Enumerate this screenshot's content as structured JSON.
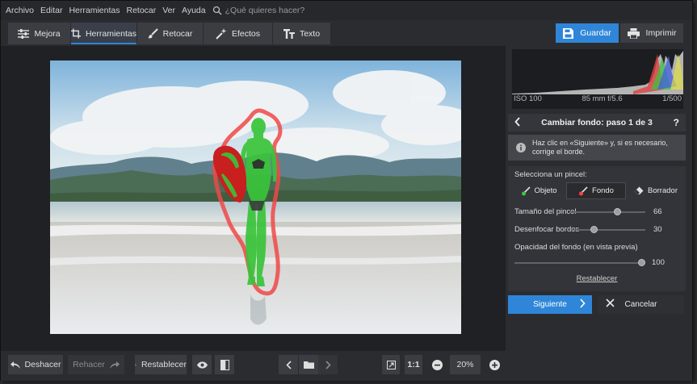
{
  "menu": {
    "items": [
      "Archivo",
      "Editar",
      "Herramientas",
      "Retocar",
      "Ver",
      "Ayuda"
    ],
    "search_placeholder": "¿Qué quieres hacer?"
  },
  "tabs": [
    {
      "label": "Mejora",
      "icon": "sliders-icon"
    },
    {
      "label": "Herramientas",
      "icon": "crop-icon",
      "active": true
    },
    {
      "label": "Retocar",
      "icon": "brush-icon"
    },
    {
      "label": "Efectos",
      "icon": "magic-wand-icon"
    },
    {
      "label": "Texto",
      "icon": "text-icon"
    }
  ],
  "toolbar": {
    "save_label": "Guardar",
    "print_label": "Imprimir"
  },
  "panel": {
    "exif": {
      "iso": "ISO 100",
      "lens": "85 mm f/5.6",
      "shutter": "1/500"
    },
    "step_title": "Cambiar fondo: paso 1 de 3",
    "help_label": "?",
    "info_text": "Haz clic en «Siguiente» y, si es necesario, corrige el borde.",
    "brush_label": "Selecciona un pincel:",
    "brushes": [
      "Objeto",
      "Fondo",
      "Borrador"
    ],
    "active_brush": "Fondo",
    "brush_size_label": "Tamaño del pincel",
    "brush_size": 66,
    "blur_label": "Desenfocar bordes",
    "blur": 30,
    "opacity_label": "Opacidad del fondo (en vista previa)",
    "opacity": 100,
    "reset_label": "Restablecer",
    "next_label": "Siguiente",
    "cancel_label": "Cancelar"
  },
  "bottombar": {
    "undo_label": "Deshacer",
    "redo_label": "Rehacer",
    "reset_label": "Restablecer",
    "actual_size_label": "1:1",
    "zoom": "20%"
  },
  "colors": {
    "accent": "#2f86d8",
    "object_mask": "#3cc83c",
    "background_mask": "#ff4040"
  }
}
